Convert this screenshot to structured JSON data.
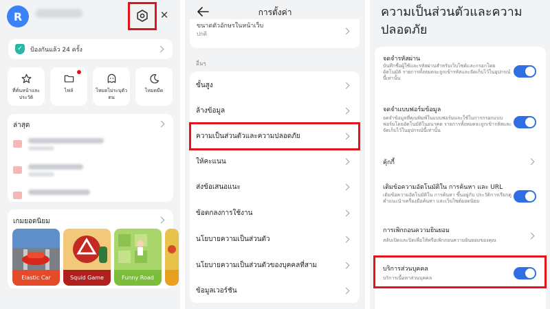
{
  "colors": {
    "accent": "#2f6fe4",
    "highlight": "#e3121a",
    "shield": "#28b8a8",
    "background": "#f2f3f5"
  },
  "home": {
    "avatar_letter": "R",
    "protection_text": "ป้องกันแล้ว 24 ครั้ง",
    "quick_tiles": [
      {
        "label": "ที่คั่นหน้าและประวัติ",
        "icon": "star-icon"
      },
      {
        "label": "ไฟล์",
        "icon": "folder-icon"
      },
      {
        "label": "โหมดไม่ระบุตัวตน",
        "icon": "incognito-icon"
      },
      {
        "label": "โหมดมืด",
        "icon": "moon-icon"
      }
    ],
    "recent_title": "ล่าสุด",
    "games_title": "เกมยอดนิยม",
    "games": [
      {
        "name": "Elastic Car",
        "color": "#e44b2a"
      },
      {
        "name": "Squid Game",
        "color": "#b0201e"
      },
      {
        "name": "Funny Road",
        "color": "#7cbd3b"
      }
    ]
  },
  "settings": {
    "title": "การตั้งค่า",
    "top_item_label": "ขนาดตัวอักษรในหน้าเว็บ",
    "top_item_value": "ปกติ",
    "section_label": "อื่นๆ",
    "items": [
      "ขั้นสูง",
      "ล้างข้อมูล",
      "ความเป็นส่วนตัวและความปลอดภัย",
      "ให้คะแนน",
      "ส่งข้อเสนอแนะ",
      "ข้อตกลงการใช้งาน",
      "นโยบายความเป็นส่วนตัว",
      "นโยบายความเป็นส่วนตัวของบุคคลที่สาม",
      "ข้อมูลเวอร์ชัน"
    ]
  },
  "privacy": {
    "title": "ความเป็นส่วนตัวและความปลอดภัย",
    "items": [
      {
        "label": "จดจำรหัสผ่าน",
        "desc": "บันทึกชื่อผู้ใช้และรหัสผ่านสำหรับเว็บไซต์และกรอกโดยอัตโนมัติ รายการทั้งหมดจะถูกเข้ารหัสและจัดเก็บไว้ในอุปกรณ์นี้เท่านั้น",
        "control": "toggle",
        "on": true
      },
      {
        "label": "จดจำแบบฟอร์มข้อมูล",
        "desc": "จดจำข้อมูลที่คุณพิมพ์ในแบบฟอร์มและใช้ในการกรอกแบบฟอร์มโดยอัตโนมัติในอนาคต รายการทั้งหมดจะถูกเข้ารหัสและจัดเก็บไว้ในอุปกรณ์นี้เท่านั้น",
        "control": "toggle",
        "on": true
      },
      {
        "label": "คุ้กกี้",
        "desc": "",
        "control": "chevron"
      },
      {
        "label": "เติมข้อความอัตโนมัติใน การค้นหา และ URL",
        "desc": "เติมข้อความอัตโนมัติใน การค้นหา ขึ้นอยู่กับ ประวัติการเรียกดู คำแนะนำเครื่องมือค้นหา และเว็บไซต์ยอดนิยม",
        "control": "toggle",
        "on": true
      },
      {
        "label": "การเพิกถอนความยินยอม",
        "desc": "สลับเปิดและปิดเพื่อให้หรือเพิกถอนความยินยอมของคุณ",
        "control": "chevron"
      },
      {
        "label": "บริการส่วนบุคคล",
        "desc": "บริการเนื้อหาส่วนบุคคล",
        "control": "toggle",
        "on": true
      }
    ]
  }
}
